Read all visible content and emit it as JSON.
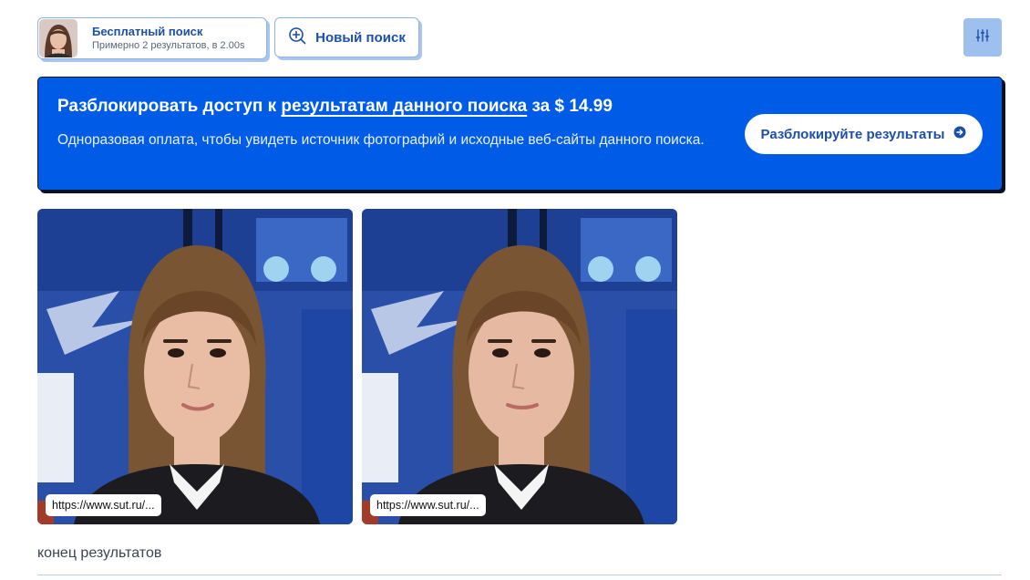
{
  "header": {
    "search_chip": {
      "title": "Бесплатный поиск",
      "subtitle": "Примерно 2 результатов, в 2.00s",
      "avatar_icon": "face-thumbnail"
    },
    "new_search": {
      "label": "Новый поиск",
      "icon": "zoom-in-icon"
    },
    "filter_button": {
      "icon": "sliders-icon"
    }
  },
  "banner": {
    "title_prefix": "Разблокировать доступ к ",
    "title_link": "результатам данного поиска",
    "title_suffix": " за $ 14.99",
    "description": "Одноразовая оплата, чтобы увидеть источник фотографий и исходные веб-сайты данного поиска.",
    "button_label": "Разблокируйте результаты",
    "button_icon": "arrow-right-circle-icon"
  },
  "results": [
    {
      "url": "https://www.sut.ru/..."
    },
    {
      "url": "https://www.sut.ru/..."
    }
  ],
  "footer": {
    "end_label": "конец результатов"
  },
  "colors": {
    "accent": "#005ce6",
    "brand_text": "#1c4fa8",
    "chip_border": "#8fb3e6",
    "filter_bg": "#9ec0ee"
  }
}
